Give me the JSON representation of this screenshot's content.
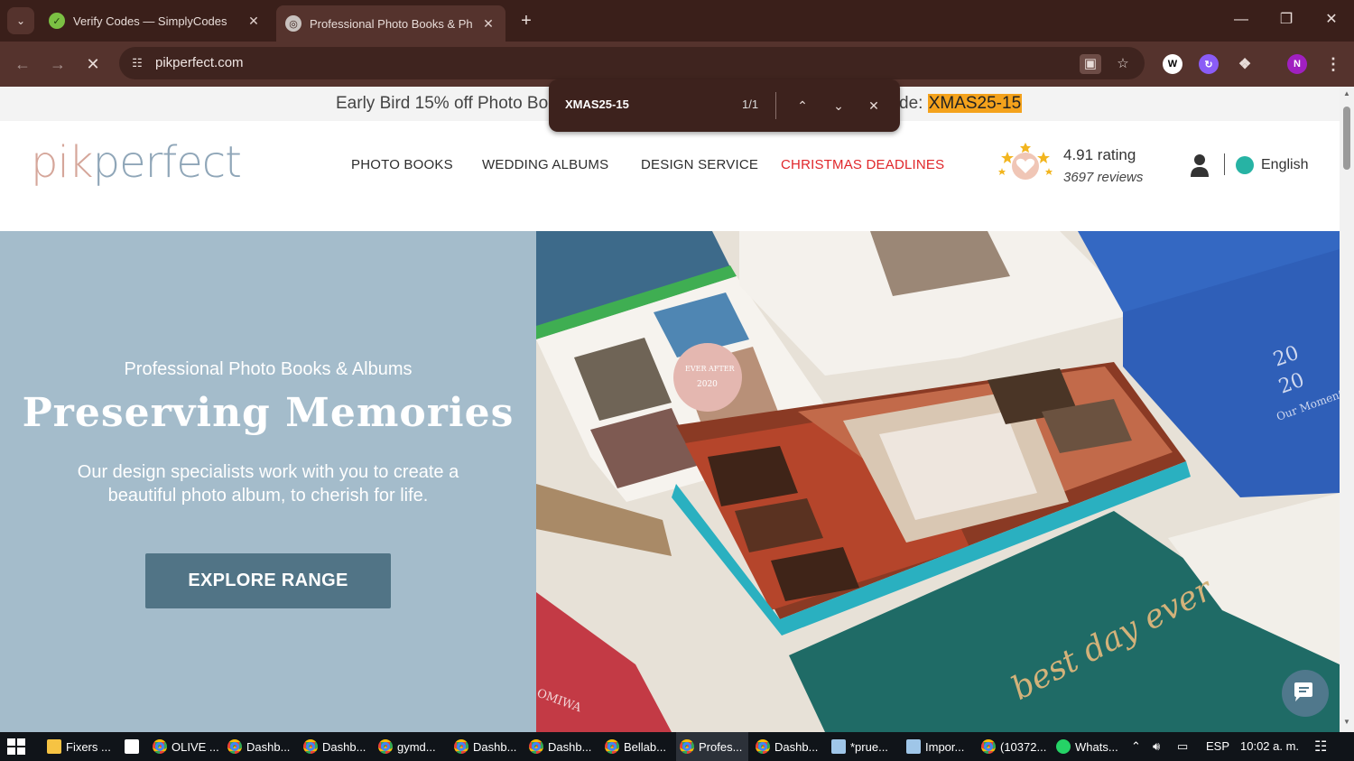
{
  "browser": {
    "tabs": [
      {
        "title": "Verify Codes — SimplyCodes",
        "active": false
      },
      {
        "title": "Professional Photo Books & Ph",
        "active": true
      }
    ],
    "url": "pikperfect.com"
  },
  "find_bar": {
    "query": "XMAS25-15",
    "count": "1/1"
  },
  "promo": {
    "left_text": "Early Bird 15% off Photo Boo",
    "right_text": "de: ",
    "code": "XMAS25-15"
  },
  "header": {
    "logo_left": "pik",
    "logo_right": "perfect",
    "nav": [
      "PHOTO BOOKS",
      "WEDDING ALBUMS",
      "DESIGN SERVICE",
      "CHRISTMAS DEADLINES"
    ],
    "rating": "4.91 rating",
    "reviews": "3697 reviews",
    "language": "English"
  },
  "hero": {
    "subtitle": "Professional Photo Books & Albums",
    "title": "Preserving Memories",
    "description": "Our design specialists work with you to create a beautiful photo album, to cherish for life.",
    "cta": "EXPLORE RANGE",
    "image_texts": {
      "cover_blue_year_top": "20",
      "cover_blue_year_bottom": "20",
      "cover_blue_words": "Our Moment Togeth",
      "cover_green": "best day ever",
      "cover_red": "OMIWA",
      "seal_top": "EVER AFTER",
      "seal_year": "2020"
    }
  },
  "taskbar": {
    "items": [
      "Fixers ...",
      "OLIVE ...",
      "Dashb...",
      "Dashb...",
      "gymd...",
      "Dashb...",
      "Dashb...",
      "Bellab...",
      "Profes...",
      "Dashb...",
      "*prue...",
      "Impor...",
      "(10372...",
      "Whats..."
    ],
    "language": "ESP",
    "time": "10:02 a. m."
  },
  "colors": {
    "accent_red": "#e0262a",
    "cta": "#517486",
    "hero_bg": "#a4bccb",
    "browser_frame": "#3a1f1a",
    "highlight": "#f4a21c"
  }
}
